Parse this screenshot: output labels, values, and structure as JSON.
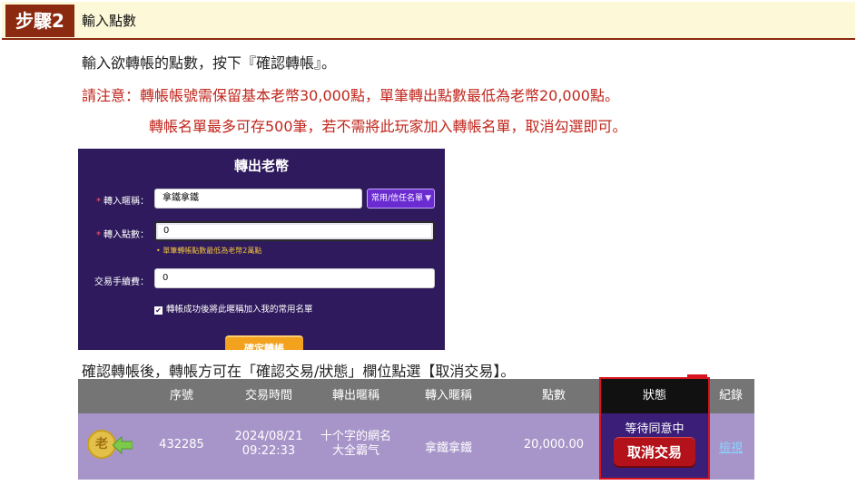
{
  "step": {
    "badge": "步驟2",
    "title": "輸入點數"
  },
  "text": {
    "line1": "輸入欲轉帳的點數，按下『確認轉帳』。",
    "note1": "請注意：轉帳帳號需保留基本老幣30,000點，單筆轉出點數最低為老幣20,000點。",
    "note2": "轉帳名單最多可存500筆，若不需將此玩家加入轉帳名單，取消勾選即可。",
    "line2": "確認轉帳後，轉帳方可在「確認交易/狀態」欄位點選【取消交易】。"
  },
  "form": {
    "title": "轉出老幣",
    "nickname_label": "轉入暱稱：",
    "nickname_value": "拿鐵拿鐵",
    "list_button": "常用/信任名單",
    "points_label": "轉入點數：",
    "points_value": "0",
    "hint": "• 單筆轉帳點數最低為老幣2萬點",
    "fee_label": "交易手續費：",
    "fee_value": "0",
    "checkbox_label": "轉帳成功後將此暱稱加入我的常用名單",
    "checkbox_checked": true,
    "confirm_button": "確定轉帳"
  },
  "table": {
    "headers": [
      "序號",
      "交易時間",
      "轉出暱稱",
      "轉入暱稱",
      "點數",
      "狀態",
      "紀錄"
    ],
    "row": {
      "id": "432285",
      "date": "2024/08/21",
      "time": "09:22:33",
      "from_line1": "十个字的網名",
      "from_line2": "大全霸气",
      "to": "拿鐵拿鐵",
      "points": "20,000.00",
      "status": "等待同意中",
      "cancel_button": "取消交易",
      "view_link": "檢視"
    }
  },
  "colors": {
    "accent": "#8b2a10",
    "panel": "#2e1a5c",
    "cancel": "#b4121a",
    "highlight_border": "#d8141e"
  }
}
